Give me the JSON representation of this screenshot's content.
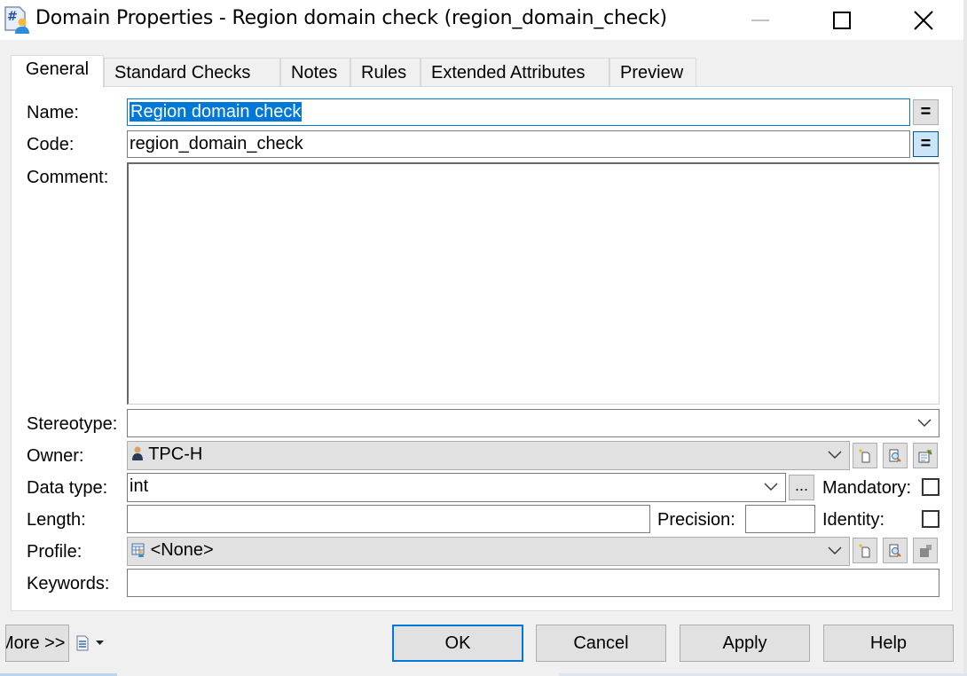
{
  "window": {
    "title": "Domain Properties - Region domain check (region_domain_check)",
    "icon": "domain-properties-icon",
    "controls": {
      "minimize": "minimize-icon",
      "maximize": "maximize-icon",
      "close": "close-icon"
    }
  },
  "tabs": [
    {
      "label": "General",
      "active": true
    },
    {
      "label": "Standard Checks",
      "active": false
    },
    {
      "label": "Notes",
      "active": false
    },
    {
      "label": "Rules",
      "active": false
    },
    {
      "label": "Extended Attributes",
      "active": false
    },
    {
      "label": "Preview",
      "active": false
    }
  ],
  "form": {
    "name": {
      "label": "Name:",
      "value": "Region domain check",
      "selected": true
    },
    "code": {
      "label": "Code:",
      "value": "region_domain_check"
    },
    "equals_label": "=",
    "comment": {
      "label": "Comment:",
      "value": ""
    },
    "stereotype": {
      "label": "Stereotype:",
      "value": ""
    },
    "owner": {
      "label": "Owner:",
      "value": "TPC-H",
      "icon": "user-icon"
    },
    "data_type": {
      "label": "Data type:",
      "value": "int",
      "ellipsis": "..."
    },
    "mandatory": {
      "label": "Mandatory:",
      "checked": false
    },
    "length": {
      "label": "Length:",
      "value": ""
    },
    "precision": {
      "label": "Precision:",
      "value": ""
    },
    "identity": {
      "label": "Identity:",
      "checked": false
    },
    "profile": {
      "label": "Profile:",
      "value": "<None>",
      "icon": "profile-icon"
    },
    "keywords": {
      "label": "Keywords:",
      "value": ""
    },
    "owner_buttons": [
      "new-icon",
      "properties-search-icon",
      "edit-properties-icon"
    ],
    "profile_buttons": [
      "new-icon",
      "properties-search-icon",
      "edit-properties-disabled-icon"
    ]
  },
  "footer": {
    "more": "More >>",
    "ok": "OK",
    "cancel": "Cancel",
    "apply": "Apply",
    "help": "Help"
  },
  "colors": {
    "accent": "#0078d7",
    "selection": "#0078d7",
    "dialog_bg": "#f0f0f0",
    "button_bg": "#e1e1e1"
  }
}
